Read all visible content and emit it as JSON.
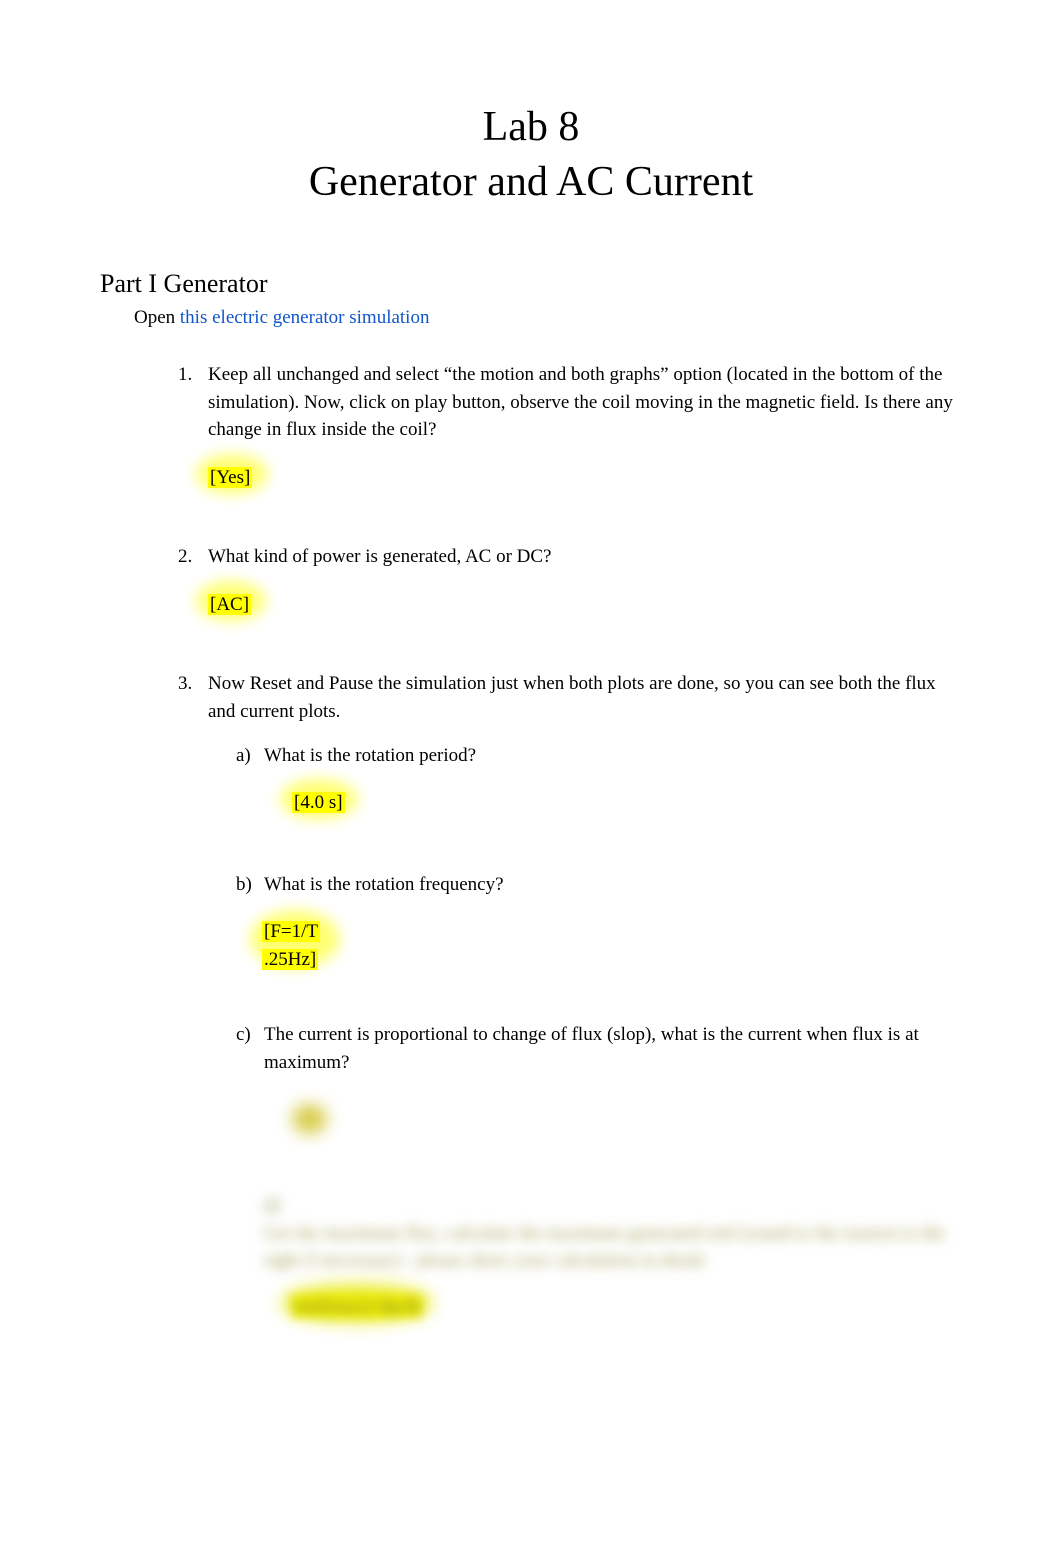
{
  "title": {
    "line1": "Lab 8",
    "line2": "Generator and AC Current"
  },
  "section_heading": "Part I Generator",
  "open_prefix": "Open ",
  "open_link": "this electric generator simulation",
  "questions": [
    {
      "num": "1.",
      "text": "Keep all unchanged and select “the motion and both graphs” option (located in the bottom of the simulation).   Now, click on play button, observe the coil moving in the magnetic field.  Is there any change in flux inside the coil?",
      "answer": "[Yes]"
    },
    {
      "num": "2.",
      "text": "What kind of power is generated, AC or DC?",
      "answer": "[AC]"
    },
    {
      "num": "3.",
      "text": "Now Reset and Pause the simulation just when both plots are done, so you can see both the flux and current plots.",
      "subs": [
        {
          "letter": "a)",
          "text": "What is the rotation period?",
          "answer": "[4.0 s]"
        },
        {
          "letter": "b)",
          "text": "What is the rotation frequency?",
          "answer_line1": "[F=1/T",
          "answer_line2": ".25Hz]"
        },
        {
          "letter": "c)",
          "text": "The current is proportional to change of flux (slop), what is the current when flux is at maximum?"
        },
        {
          "letter": "d)",
          "text_blurred": "Get the maximum flux, calculate the maximum generated emf (round to the nearest to the right if necessary) - please show your calculation in detail.",
          "answer_blurred": "emf(max)=dφ/dt"
        }
      ]
    }
  ]
}
